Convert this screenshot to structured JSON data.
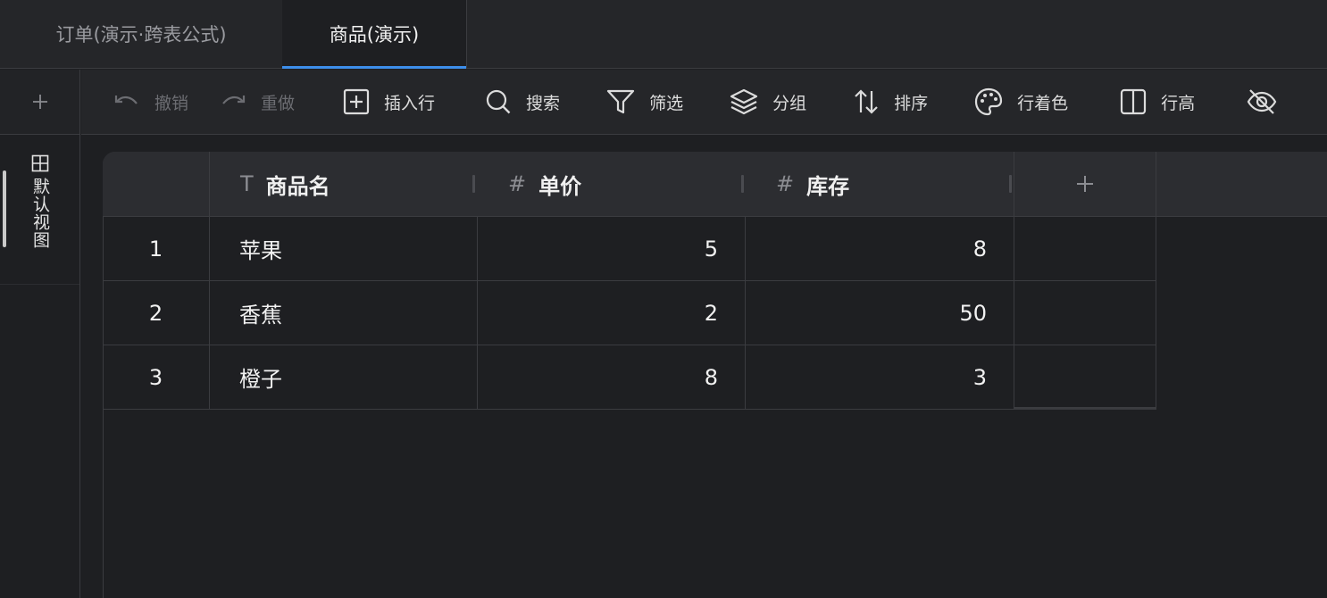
{
  "tabs": [
    {
      "label": "订单(演示·跨表公式)"
    },
    {
      "label": "商品(演示)"
    }
  ],
  "views": [
    {
      "label": "默认视图",
      "icon": "table-icon"
    }
  ],
  "toolbar": {
    "undo": "撤销",
    "redo": "重做",
    "insert_row": "插入行",
    "search": "搜索",
    "filter": "筛选",
    "group": "分组",
    "sort": "排序",
    "row_color": "行着色",
    "row_height": "行高"
  },
  "columns": [
    {
      "label": "商品名",
      "type_icon": "T"
    },
    {
      "label": "单价",
      "type_icon": "#"
    },
    {
      "label": "库存",
      "type_icon": "#"
    }
  ],
  "rows": [
    {
      "index": "1",
      "name": "苹果",
      "price": "5",
      "stock": "8"
    },
    {
      "index": "2",
      "name": "香蕉",
      "price": "2",
      "stock": "50"
    },
    {
      "index": "3",
      "name": "橙子",
      "price": "8",
      "stock": "3"
    }
  ],
  "colors": {
    "accent": "#3d8eea",
    "background": "#1e1f22",
    "header": "#2c2d31"
  }
}
